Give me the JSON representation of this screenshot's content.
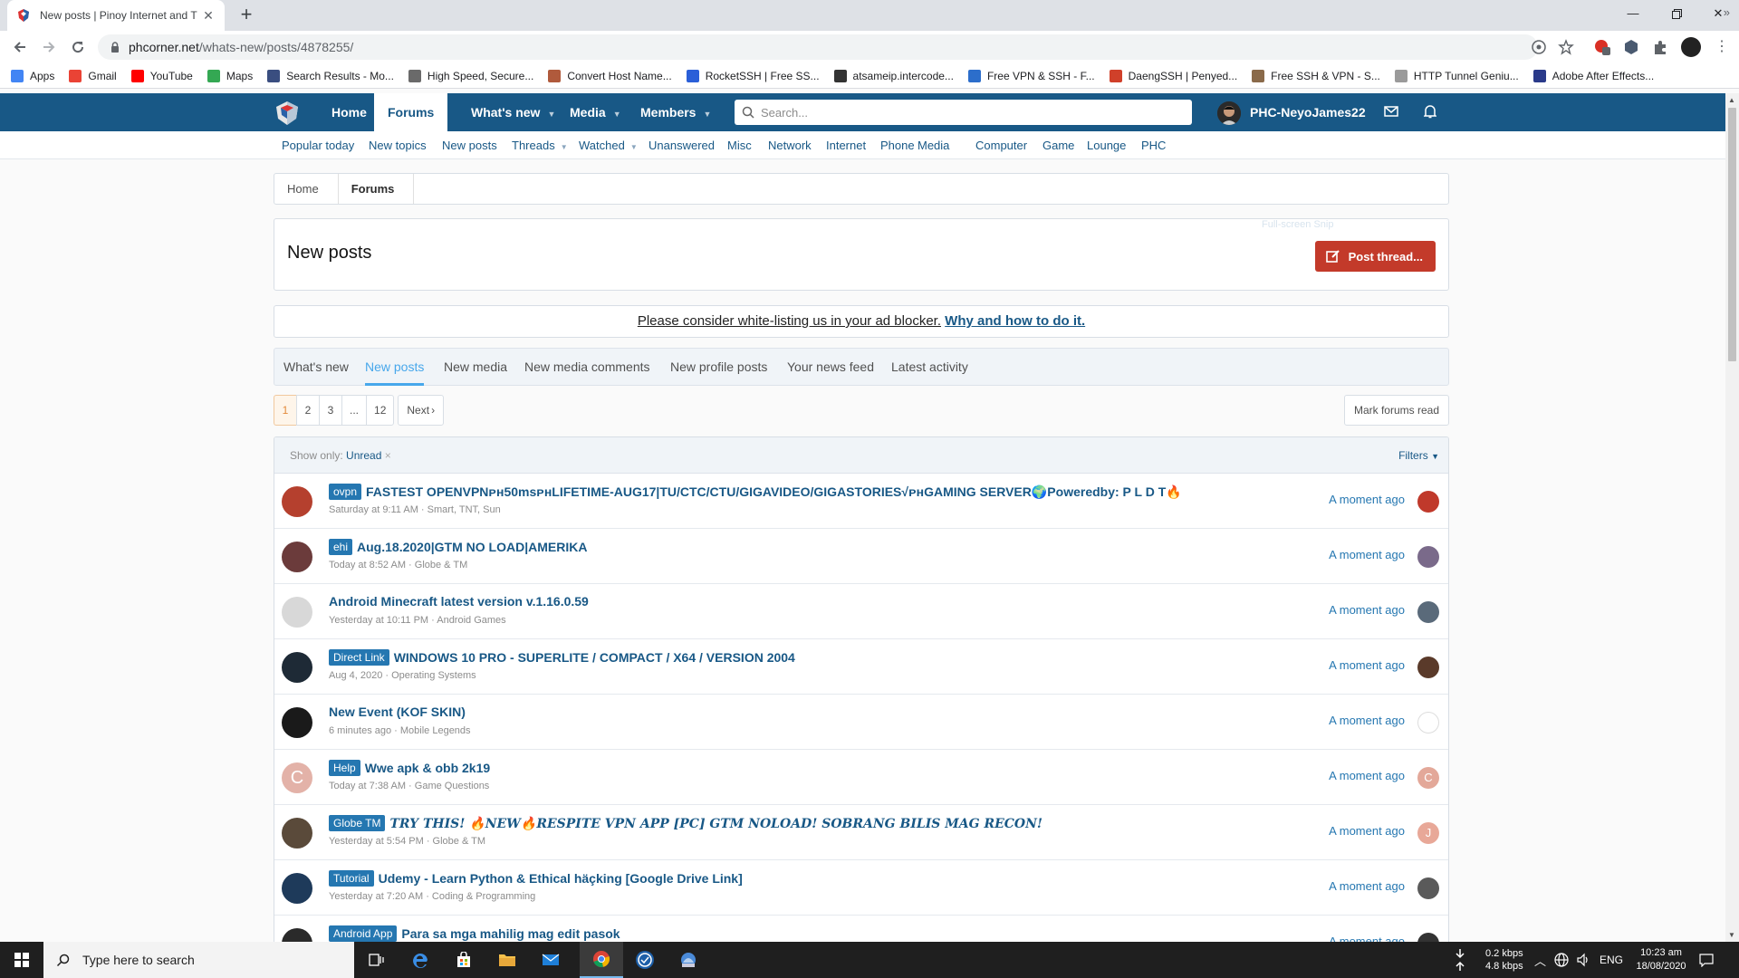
{
  "browser": {
    "tab_title": "New posts | Pinoy Internet and T",
    "url_host": "phcorner.net",
    "url_path": "/whats-new/posts/4878255/",
    "bookmarks": [
      {
        "label": "Apps",
        "color": "#4285f4"
      },
      {
        "label": "Gmail",
        "color": "#ea4335"
      },
      {
        "label": "YouTube",
        "color": "#ff0000"
      },
      {
        "label": "Maps",
        "color": "#34a853"
      },
      {
        "label": "Search Results - Mo...",
        "color": "#3a4e80"
      },
      {
        "label": "High Speed, Secure...",
        "color": "#6a6a6a"
      },
      {
        "label": "Convert Host Name...",
        "color": "#b05a3c"
      },
      {
        "label": "RocketSSH | Free SS...",
        "color": "#2a5fd8"
      },
      {
        "label": "atsameip.intercode...",
        "color": "#333333"
      },
      {
        "label": "Free VPN & SSH - F...",
        "color": "#2c6ecb"
      },
      {
        "label": "DaengSSH | Penyed...",
        "color": "#d0402a"
      },
      {
        "label": "Free SSH & VPN - S...",
        "color": "#8a6a4a"
      },
      {
        "label": "HTTP Tunnel Geniu...",
        "color": "#9a9a9a"
      },
      {
        "label": "Adobe After Effects...",
        "color": "#2a3a8a"
      }
    ]
  },
  "forum": {
    "nav_tabs": [
      {
        "label": "Home",
        "caret": true
      },
      {
        "label": "Forums",
        "caret": false
      },
      {
        "label": "What's new",
        "caret": true
      },
      {
        "label": "Media",
        "caret": true
      },
      {
        "label": "Members",
        "caret": true
      }
    ],
    "search_placeholder": "Search...",
    "username": "PHC-NeyoJames22",
    "subnav": [
      {
        "label": "Popular today",
        "caret": false
      },
      {
        "label": "New topics",
        "caret": false
      },
      {
        "label": "New posts",
        "caret": false
      },
      {
        "label": "Threads",
        "caret": true
      },
      {
        "label": "Watched",
        "caret": true
      },
      {
        "label": "Unanswered",
        "caret": false
      },
      {
        "label": "Misc",
        "caret": false
      },
      {
        "label": "Network",
        "caret": false
      },
      {
        "label": "Internet",
        "caret": false
      },
      {
        "label": "Phone",
        "caret": false
      },
      {
        "label": "Media",
        "caret": false
      },
      {
        "label": "Computer",
        "caret": false
      },
      {
        "label": "Game",
        "caret": false
      },
      {
        "label": "Lounge",
        "caret": false
      },
      {
        "label": "PHC",
        "caret": false
      }
    ],
    "breadcrumb": [
      "Home",
      "Forums"
    ],
    "page_title": "New posts",
    "post_thread_label": "Post thread...",
    "ghost_label": "Full-screen Snip",
    "ad_notice_text": "Please consider white-listing us in your ad blocker.",
    "ad_notice_link": "Why and how to do it.",
    "filter_tabs": [
      "What's new",
      "New posts",
      "New media",
      "New media comments",
      "New profile posts",
      "Your news feed",
      "Latest activity"
    ],
    "active_filter_tab": "New posts",
    "pages": [
      "1",
      "2",
      "3",
      "...",
      "12"
    ],
    "next_label": "Next",
    "mark_read_label": "Mark forums read",
    "show_only_label": "Show only:",
    "show_only_value": "Unread",
    "filters_label": "Filters",
    "threads": [
      {
        "prefix": "ovpn",
        "title": "FASTEST OPENVPNᴘʜ50msᴘʜLIFETIME-AUG17|TU/CTC/CTU/GIGAVIDEO/GIGASTORIES√ᴘʜGAMING SERVER🌍Poweredby: P L D T🔥",
        "meta": "Saturday at 9:11 AM · Smart, TNT, Sun",
        "time": "A moment ago",
        "avatar_color": "#b5402e",
        "side_color": "#c0392b"
      },
      {
        "prefix": "ehi",
        "title": "Aug.18.2020|GTM NO LOAD|AMERIKA",
        "meta": "Today at 8:52 AM · Globe & TM",
        "time": "A moment ago",
        "avatar_color": "#6b3b3b",
        "side_color": "#7a6a8a"
      },
      {
        "prefix": "",
        "title": "Android Minecraft latest version v.1.16.0.59",
        "meta": "Yesterday at 10:11 PM · Android Games",
        "time": "A moment ago",
        "avatar_color": "#d8d8d8",
        "side_color": "#5a6a7a"
      },
      {
        "prefix": "Direct Link",
        "title": "WINDOWS 10 PRO - SUPERLITE / COMPACT / X64 / VERSION 2004",
        "meta": "Aug 4, 2020 · Operating Systems",
        "time": "A moment ago",
        "avatar_color": "#1e2a36",
        "side_color": "#5a3a2a"
      },
      {
        "prefix": "",
        "title": "New Event (KOF SKIN)",
        "meta": "6 minutes ago · Mobile Legends",
        "time": "A moment ago",
        "avatar_color": "#1a1a1a",
        "side_color": "#ffffff"
      },
      {
        "prefix": "Help",
        "title": "Wwe apk & obb 2k19",
        "meta": "Today at 7:38 AM · Game Questions",
        "time": "A moment ago",
        "avatar_color": "#e3b2a8",
        "side_color": "#e3a899",
        "letter": "C"
      },
      {
        "prefix": "Globe TM",
        "title": "TRY THIS! 🔥NEW🔥RESPITE VPN APP [PC] GTM NOLOAD! SOBRANG BILIS MAG RECON!",
        "meta": "Yesterday at 5:54 PM · Globe & TM",
        "time": "A moment ago",
        "avatar_color": "#5a4a3a",
        "side_color": "#e8a898",
        "letter_side": "J",
        "serif": true
      },
      {
        "prefix": "Tutorial",
        "title": "Udemy - Learn Python & Ethical häçking [Google Drive Link]",
        "meta": "Yesterday at 7:20 AM · Coding & Programming",
        "time": "A moment ago",
        "avatar_color": "#1e3a5a",
        "side_color": "#5a5a5a"
      },
      {
        "prefix": "Android App",
        "title": "Para sa mga mahilig mag edit pasok",
        "meta": "",
        "time": "A moment ago",
        "avatar_color": "#2a2a2a",
        "side_color": "#333333"
      }
    ]
  },
  "taskbar": {
    "search_placeholder": "Type here to search",
    "net_down": "0.2 kbps",
    "net_up": "4.8 kbps",
    "lang": "ENG",
    "time": "10:23 am",
    "date": "18/08/2020"
  }
}
